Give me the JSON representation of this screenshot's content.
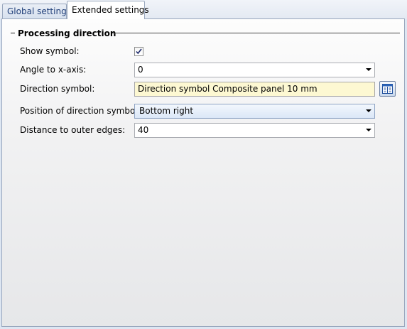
{
  "tabs": [
    {
      "label": "Global settings",
      "active": false
    },
    {
      "label": "Extended settings",
      "active": true
    }
  ],
  "group": {
    "title": "Processing direction",
    "collapse_icon": "collapse-minus-icon"
  },
  "fields": {
    "show_symbol": {
      "label": "Show symbol:",
      "checked": true
    },
    "angle": {
      "label": "Angle to x-axis:",
      "value": "0",
      "icon": "chevron-down-icon"
    },
    "direction_symbol": {
      "label": "Direction symbol:",
      "value": "Direction symbol Composite panel 10 mm",
      "button_icon": "catalog-browse-icon"
    },
    "position": {
      "label": "Position of direction symbol:",
      "value": "Bottom right",
      "icon": "chevron-down-icon"
    },
    "distance": {
      "label": "Distance to outer edges:",
      "value": "40",
      "icon": "chevron-down-icon"
    }
  },
  "colors": {
    "background": "#dde6f2",
    "highlight_field": "#fdf8d2",
    "selected_combo": "#dbe7f7",
    "tab_text": "#1f3e78"
  }
}
